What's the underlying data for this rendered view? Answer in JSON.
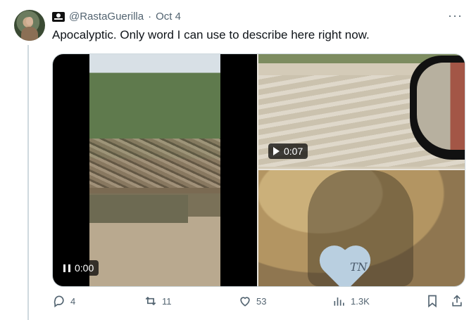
{
  "post": {
    "handle": "@RastaGuerilla",
    "separator": "·",
    "date": "Oct 4",
    "text": "Apocalyptic. Only word I can use to describe here right now.",
    "more": "···"
  },
  "media": {
    "video1": {
      "duration": "0:00"
    },
    "video2": {
      "duration": "0:07"
    },
    "photo_text": "TN"
  },
  "actions": {
    "replies": "4",
    "reposts": "11",
    "likes": "53",
    "views": "1.3K"
  },
  "colors": {
    "text": "#0f1419",
    "muted": "#536471",
    "border": "#cfd9de"
  }
}
